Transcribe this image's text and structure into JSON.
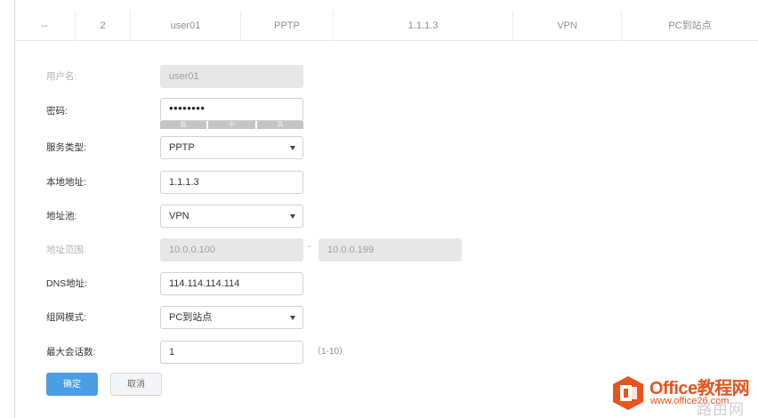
{
  "table": {
    "cells": [
      "--",
      "2",
      "user01",
      "PPTP",
      "1.1.1.3",
      "VPN",
      "PC到站点"
    ]
  },
  "form": {
    "username": {
      "label": "用户名:",
      "value": "user01"
    },
    "password": {
      "label": "密码:",
      "value": "••••••••",
      "strength": [
        "低",
        "中",
        "高"
      ]
    },
    "service_type": {
      "label": "服务类型:",
      "value": "PPTP"
    },
    "local_address": {
      "label": "本地地址:",
      "value": "1.1.1.3"
    },
    "address_pool": {
      "label": "地址池:",
      "value": "VPN"
    },
    "address_range": {
      "label": "地址范围:",
      "start": "10.0.0.100",
      "separator": "-",
      "end": "10.0.0.199"
    },
    "dns": {
      "label": "DNS地址:",
      "value": "114.114.114.114"
    },
    "network_mode": {
      "label": "组网模式:",
      "value": "PC到站点"
    },
    "max_sessions": {
      "label": "最大会话数:",
      "value": "1",
      "hint": "（1-10）"
    }
  },
  "buttons": {
    "ok": "确定",
    "cancel": "取消"
  },
  "watermark": {
    "title": "Office教程网",
    "url": "www.office26.com",
    "faint": "路由网"
  },
  "colors": {
    "primary": "#4a9ee6",
    "watermark": "#e8541e",
    "disabled_bg": "#e7e7e7"
  }
}
